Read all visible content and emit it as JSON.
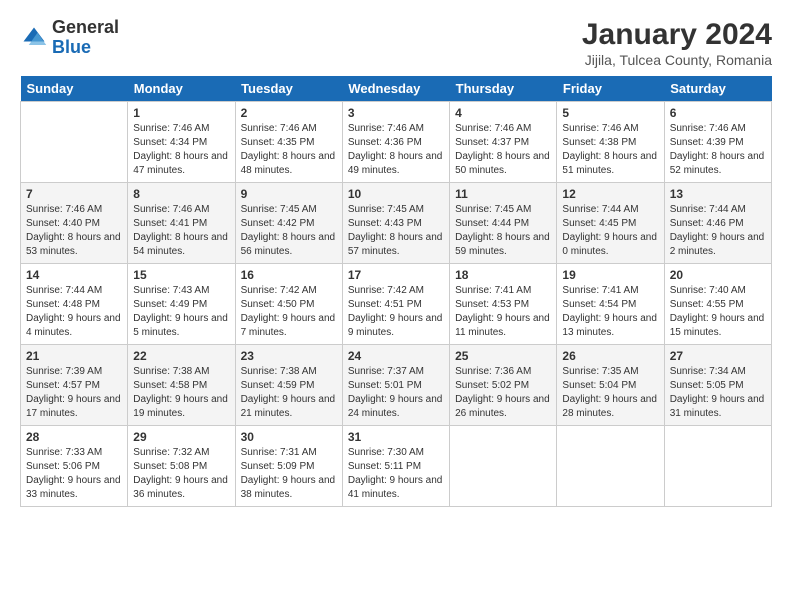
{
  "logo": {
    "general": "General",
    "blue": "Blue"
  },
  "title": "January 2024",
  "subtitle": "Jijila, Tulcea County, Romania",
  "headers": [
    "Sunday",
    "Monday",
    "Tuesday",
    "Wednesday",
    "Thursday",
    "Friday",
    "Saturday"
  ],
  "weeks": [
    [
      {
        "day": "",
        "sunrise": "",
        "sunset": "",
        "daylight": ""
      },
      {
        "day": "1",
        "sunrise": "7:46 AM",
        "sunset": "4:34 PM",
        "daylight": "8 hours and 47 minutes."
      },
      {
        "day": "2",
        "sunrise": "7:46 AM",
        "sunset": "4:35 PM",
        "daylight": "8 hours and 48 minutes."
      },
      {
        "day": "3",
        "sunrise": "7:46 AM",
        "sunset": "4:36 PM",
        "daylight": "8 hours and 49 minutes."
      },
      {
        "day": "4",
        "sunrise": "7:46 AM",
        "sunset": "4:37 PM",
        "daylight": "8 hours and 50 minutes."
      },
      {
        "day": "5",
        "sunrise": "7:46 AM",
        "sunset": "4:38 PM",
        "daylight": "8 hours and 51 minutes."
      },
      {
        "day": "6",
        "sunrise": "7:46 AM",
        "sunset": "4:39 PM",
        "daylight": "8 hours and 52 minutes."
      }
    ],
    [
      {
        "day": "7",
        "sunrise": "7:46 AM",
        "sunset": "4:40 PM",
        "daylight": "8 hours and 53 minutes."
      },
      {
        "day": "8",
        "sunrise": "7:46 AM",
        "sunset": "4:41 PM",
        "daylight": "8 hours and 54 minutes."
      },
      {
        "day": "9",
        "sunrise": "7:45 AM",
        "sunset": "4:42 PM",
        "daylight": "8 hours and 56 minutes."
      },
      {
        "day": "10",
        "sunrise": "7:45 AM",
        "sunset": "4:43 PM",
        "daylight": "8 hours and 57 minutes."
      },
      {
        "day": "11",
        "sunrise": "7:45 AM",
        "sunset": "4:44 PM",
        "daylight": "8 hours and 59 minutes."
      },
      {
        "day": "12",
        "sunrise": "7:44 AM",
        "sunset": "4:45 PM",
        "daylight": "9 hours and 0 minutes."
      },
      {
        "day": "13",
        "sunrise": "7:44 AM",
        "sunset": "4:46 PM",
        "daylight": "9 hours and 2 minutes."
      }
    ],
    [
      {
        "day": "14",
        "sunrise": "7:44 AM",
        "sunset": "4:48 PM",
        "daylight": "9 hours and 4 minutes."
      },
      {
        "day": "15",
        "sunrise": "7:43 AM",
        "sunset": "4:49 PM",
        "daylight": "9 hours and 5 minutes."
      },
      {
        "day": "16",
        "sunrise": "7:42 AM",
        "sunset": "4:50 PM",
        "daylight": "9 hours and 7 minutes."
      },
      {
        "day": "17",
        "sunrise": "7:42 AM",
        "sunset": "4:51 PM",
        "daylight": "9 hours and 9 minutes."
      },
      {
        "day": "18",
        "sunrise": "7:41 AM",
        "sunset": "4:53 PM",
        "daylight": "9 hours and 11 minutes."
      },
      {
        "day": "19",
        "sunrise": "7:41 AM",
        "sunset": "4:54 PM",
        "daylight": "9 hours and 13 minutes."
      },
      {
        "day": "20",
        "sunrise": "7:40 AM",
        "sunset": "4:55 PM",
        "daylight": "9 hours and 15 minutes."
      }
    ],
    [
      {
        "day": "21",
        "sunrise": "7:39 AM",
        "sunset": "4:57 PM",
        "daylight": "9 hours and 17 minutes."
      },
      {
        "day": "22",
        "sunrise": "7:38 AM",
        "sunset": "4:58 PM",
        "daylight": "9 hours and 19 minutes."
      },
      {
        "day": "23",
        "sunrise": "7:38 AM",
        "sunset": "4:59 PM",
        "daylight": "9 hours and 21 minutes."
      },
      {
        "day": "24",
        "sunrise": "7:37 AM",
        "sunset": "5:01 PM",
        "daylight": "9 hours and 24 minutes."
      },
      {
        "day": "25",
        "sunrise": "7:36 AM",
        "sunset": "5:02 PM",
        "daylight": "9 hours and 26 minutes."
      },
      {
        "day": "26",
        "sunrise": "7:35 AM",
        "sunset": "5:04 PM",
        "daylight": "9 hours and 28 minutes."
      },
      {
        "day": "27",
        "sunrise": "7:34 AM",
        "sunset": "5:05 PM",
        "daylight": "9 hours and 31 minutes."
      }
    ],
    [
      {
        "day": "28",
        "sunrise": "7:33 AM",
        "sunset": "5:06 PM",
        "daylight": "9 hours and 33 minutes."
      },
      {
        "day": "29",
        "sunrise": "7:32 AM",
        "sunset": "5:08 PM",
        "daylight": "9 hours and 36 minutes."
      },
      {
        "day": "30",
        "sunrise": "7:31 AM",
        "sunset": "5:09 PM",
        "daylight": "9 hours and 38 minutes."
      },
      {
        "day": "31",
        "sunrise": "7:30 AM",
        "sunset": "5:11 PM",
        "daylight": "9 hours and 41 minutes."
      },
      {
        "day": "",
        "sunrise": "",
        "sunset": "",
        "daylight": ""
      },
      {
        "day": "",
        "sunrise": "",
        "sunset": "",
        "daylight": ""
      },
      {
        "day": "",
        "sunrise": "",
        "sunset": "",
        "daylight": ""
      }
    ]
  ]
}
